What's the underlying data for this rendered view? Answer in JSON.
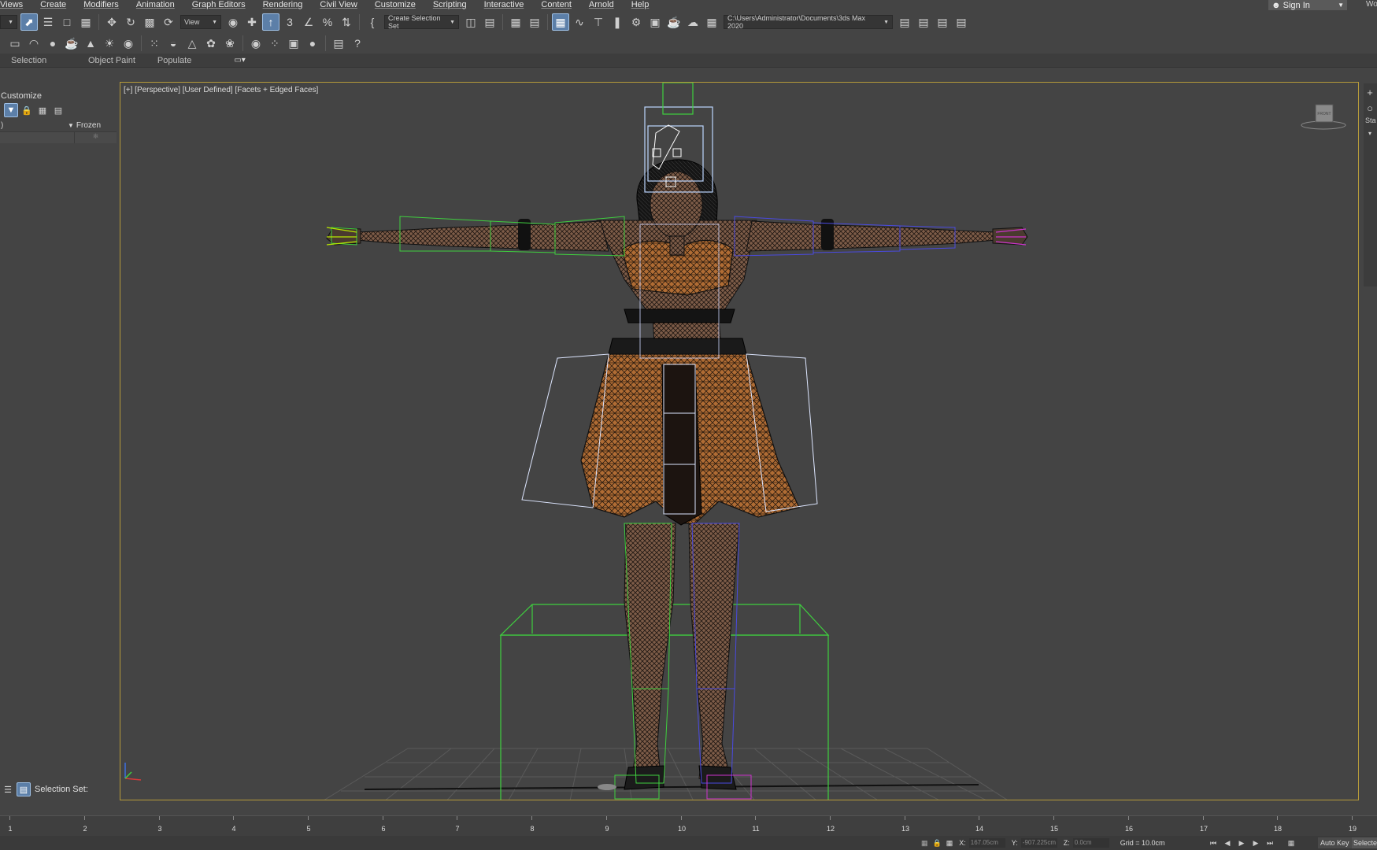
{
  "menu": [
    "Views",
    "Create",
    "Modifiers",
    "Animation",
    "Graph Editors",
    "Rendering",
    "Civil View",
    "Customize",
    "Scripting",
    "Interactive",
    "Content",
    "Arnold",
    "Help"
  ],
  "signin_label": "Sign In",
  "workspace_label": "Wor",
  "toolbar": {
    "view_dropdown": "View",
    "selection_set_dropdown": "Create Selection Set",
    "project_path": "C:\\Users\\Administrator\\Documents\\3ds Max 2020"
  },
  "ribbon": {
    "tabs": [
      "Selection",
      "Object Paint",
      "Populate"
    ]
  },
  "explorer": {
    "title": "Customize",
    "col_name": ")",
    "col_frozen": "Frozen",
    "footer_label": "Selection Set:"
  },
  "viewport": {
    "label": "[+] [Perspective] [User Defined] [Facets + Edged Faces]",
    "viewcube_label": "FRONT"
  },
  "command_panel": {
    "text": "Sta"
  },
  "timeline": {
    "ticks": [
      "1",
      "2",
      "3",
      "4",
      "5",
      "6",
      "7",
      "8",
      "9",
      "10",
      "11",
      "12",
      "13",
      "14",
      "15",
      "16",
      "17",
      "18",
      "19"
    ]
  },
  "status": {
    "x_label": "X:",
    "x_value": "167.05cm",
    "y_label": "Y:",
    "y_value": "-907.225cm",
    "z_label": "Z:",
    "z_value": "0.0cm",
    "grid": "Grid = 10.0cm",
    "autokey": "Auto Key",
    "selected": "Selected"
  },
  "colors": {
    "viewport_border": "#b59a3a",
    "active_tool": "#5c7fa8",
    "bone_green": "#3fcf3f",
    "bone_blue": "#4a4ae0",
    "skin_mesh": "#8a6a55",
    "cloth_mesh": "#b9733a"
  }
}
